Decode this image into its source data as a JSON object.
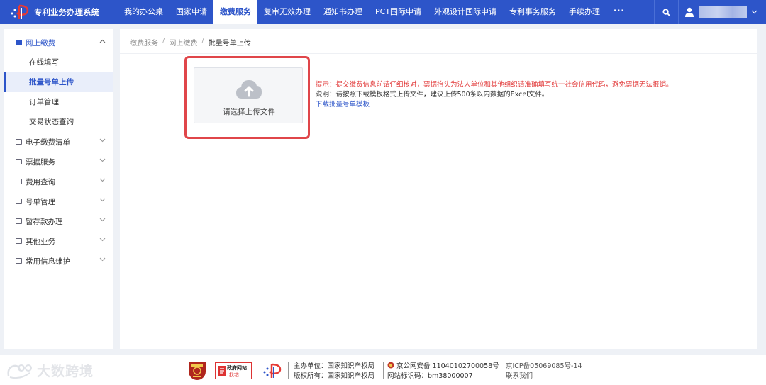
{
  "app": {
    "title": "专利业务办理系统"
  },
  "nav": {
    "items": [
      "我的办公桌",
      "国家申请",
      "缴费服务",
      "复审无效办理",
      "通知书办理",
      "PCT国际申请",
      "外观设计国际申请",
      "专利事务服务",
      "手续办理"
    ],
    "active_index": 2,
    "more": "···"
  },
  "sidebar": {
    "open_group": "网上缴费",
    "sub_items": [
      "在线填写",
      "批量号单上传",
      "订单管理",
      "交易状态查询"
    ],
    "active_sub_index": 1,
    "groups": [
      "电子缴费清单",
      "票据服务",
      "费用查询",
      "号单管理",
      "暂存款办理",
      "其他业务",
      "常用信息维护"
    ]
  },
  "breadcrumb": {
    "items": [
      "缴费服务",
      "网上缴费",
      "批量号单上传"
    ],
    "separator": "/"
  },
  "upload": {
    "label": "请选择上传文件"
  },
  "tips": {
    "warning": "提示：提交缴费信息前请仔细核对，票据抬头为法人单位和其他组织请准确填写统一社会信用代码，避免票据无法报销。",
    "note": "说明：请按照下载模板格式上传文件，建议上传500条以内数据的Excel文件。",
    "download_link": "下载批量号单模板"
  },
  "footer": {
    "watermark": "大数跨境",
    "gov_badge_top": "政府网站",
    "gov_badge_bottom": "找错",
    "host": "主办单位：国家知识产权局",
    "copyright": "版权所有：国家知识产权局",
    "police": "京公网安备 11040102700058号",
    "site_id": "网站标识码：bm38000007",
    "icp": "京ICP备05069085号-14",
    "contact": "联系我们"
  },
  "colors": {
    "primary": "#2d55c9",
    "warning": "#e23b3b",
    "highlight": "#e0464a"
  }
}
